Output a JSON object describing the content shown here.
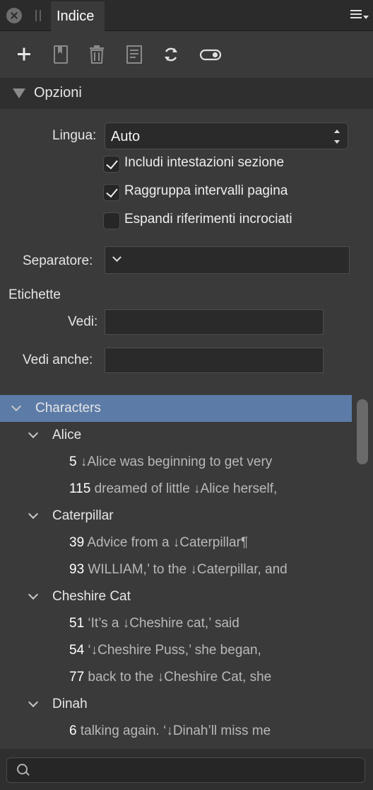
{
  "titlebar": {
    "tab_label": "Indice"
  },
  "toolbar": {
    "buttons": [
      "add-icon",
      "bookmark-icon",
      "trash-icon",
      "document-icon",
      "refresh-icon",
      "toggle-icon"
    ]
  },
  "options": {
    "header": "Opzioni",
    "language_label": "Lingua:",
    "language_value": "Auto",
    "checks": [
      {
        "label": "Includi intestazioni sezione",
        "checked": true
      },
      {
        "label": "Raggruppa intervalli pagina",
        "checked": true
      },
      {
        "label": "Espandi riferimenti incrociati",
        "checked": false
      }
    ],
    "separator_label": "Separatore:",
    "labels_heading": "Etichette",
    "see_label": "Vedi:",
    "see_also_label": "Vedi anche:"
  },
  "tree": {
    "root": "Characters",
    "groups": [
      {
        "name": "Alice",
        "refs": [
          {
            "page": "5",
            "text": "↓Alice was beginning to get very"
          },
          {
            "page": "115",
            "text": "dreamed of little ↓Alice herself,"
          }
        ]
      },
      {
        "name": "Caterpillar",
        "refs": [
          {
            "page": "39",
            "text": "Advice from a ↓Caterpillar¶"
          },
          {
            "page": "93",
            "text": "WILLIAM,’ to the ↓Caterpillar, and"
          }
        ]
      },
      {
        "name": "Cheshire Cat",
        "refs": [
          {
            "page": "51",
            "text": "‘It’s a ↓Cheshire cat,’ said"
          },
          {
            "page": "54",
            "text": "‘↓Cheshire Puss,’ she began,"
          },
          {
            "page": "77",
            "text": "back to the ↓Cheshire Cat, she"
          }
        ]
      },
      {
        "name": "Dinah",
        "refs": [
          {
            "page": "6",
            "text": "talking again. ‘↓Dinah’ll miss me"
          }
        ]
      }
    ]
  },
  "search": {
    "placeholder": ""
  },
  "colors": {
    "selected_row": "#5c7ba7",
    "panel_bg": "#3a3a3a"
  }
}
